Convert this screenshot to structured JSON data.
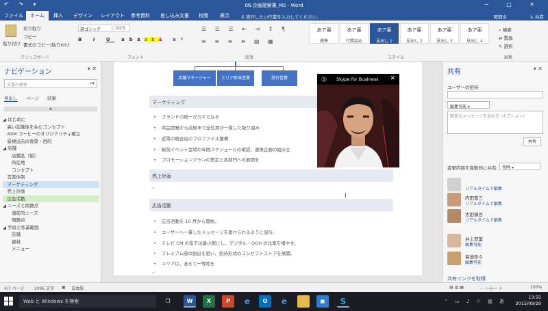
{
  "titlebar": {
    "title": "06.企画提案書_MS - Word",
    "quick_access": "↶ ↷ ▾",
    "window_controls": "─ ▢ ✕"
  },
  "tabs": {
    "items": [
      "ファイル",
      "ホーム",
      "挿入",
      "デザイン",
      "レイアウト",
      "参考資料",
      "差し込み文書",
      "校閲",
      "表示"
    ],
    "tellme": "♀ 実行したい作業を入力してください...",
    "user": "阿部文",
    "share": "♙ 共有"
  },
  "ribbon": {
    "clipboard": {
      "paste": "貼り付け",
      "cut": "切り取り",
      "copy": "コピー",
      "format_painter": "書式のコピー/貼り付け",
      "group_label": "クリップボード"
    },
    "font": {
      "font_name": "游ゴシック",
      "font_size": "10.5",
      "group_label": "フォント"
    },
    "paragraph": {
      "group_label": "段落"
    },
    "styles": {
      "items": [
        {
          "sample": "あア亜",
          "name": "標準"
        },
        {
          "sample": "あア亜",
          "name": "行間詰め"
        },
        {
          "sample": "あア亜",
          "name": "見出し 1"
        },
        {
          "sample": "あア亜",
          "name": "見出し 2"
        },
        {
          "sample": "あア亜",
          "name": "見出し 3"
        },
        {
          "sample": "あア亜",
          "name": "見出し 4"
        }
      ],
      "group_label": "スタイル"
    },
    "editing": {
      "find": "検索",
      "replace": "置換",
      "select": "選択",
      "group_label": "編集"
    }
  },
  "navigation": {
    "title": "ナビゲーション",
    "search_placeholder": "文書の検索",
    "tabs": [
      "見出し",
      "ページ",
      "結果"
    ],
    "items": [
      "◢ はじめに",
      "　高い認識性を生むコンセプト",
      "　ASM コーヒーのオリジナリティ確立",
      "　新規出店の背景・目的",
      "◢ 店舗",
      "　　店舗名（仮）",
      "　　所在地",
      "　　コンセプト",
      "　営業体制",
      "　マーケティング",
      "　売上計画",
      "　広告活動",
      "◢ ニーズと問題点",
      "　　潜在的ニーズ",
      "　　問題点",
      "◢ 手段と作業範囲",
      "　　店舗",
      "　　資材",
      "　　メニュー"
    ]
  },
  "document": {
    "org_boxes": [
      "店舗マネージャー",
      "エリア担当営業",
      "受付営業"
    ],
    "sections": [
      {
        "heading": "マーケティング",
        "bullets": [
          "ブランドの統一がカギとなる",
          "商品開発から店頭まで全社員が一貫した取り組み",
          "近隣の競合店のプロファイル整備",
          "駅前イベント会場の年間スケジュールの確認、連携企画の組み立",
          "プロモーションプランの策定と各部門への展開を"
        ]
      },
      {
        "heading": "売上計画",
        "bullets": []
      },
      {
        "heading": "広告活動",
        "bullets": [
          "広告活動を 10 月から開始。",
          "ユーザーへ一貫したメッセージを届けられるように設計。",
          "テレビ CM の投下は最小限にし、デジタル・OOH の比率を増やす。",
          "プレミアム感の創出を狙い、招待形式のコンセプトストアを展開。",
          "エリアは、あえて一等地を"
        ]
      }
    ]
  },
  "skype": {
    "title": "Skype for Business"
  },
  "share_pane": {
    "title": "共有",
    "invite_label": "ユーザーの招待",
    "permission": "編集可能",
    "message_placeholder": "簡単なメッセージを含める (オプション)",
    "share_button": "共有",
    "auto_share_label": "変更内容を自動的に共有:",
    "auto_share_value": "常時",
    "people": [
      {
        "name": "",
        "status": "リアルタイムで編集"
      },
      {
        "name": "内田晋三",
        "status": "リアルタイムで編集"
      },
      {
        "name": "太田慎吾",
        "status": "リアルタイムで編集"
      },
      {
        "name": "井上双葉",
        "status": "編集可能"
      },
      {
        "name": "菊池奈々",
        "status": "編集可能"
      }
    ],
    "link": "共有リンクを取得"
  },
  "statusbar": {
    "page": "4/7 ページ",
    "words": "2006 文字",
    "lang": "日本語",
    "zoom": "100%"
  },
  "taskbar": {
    "search": "Web と Windows を検索",
    "time": "13:55",
    "date": "2015/09/29"
  },
  "colors": {
    "accent": "#2b579a",
    "org_box": "#4472c4"
  }
}
